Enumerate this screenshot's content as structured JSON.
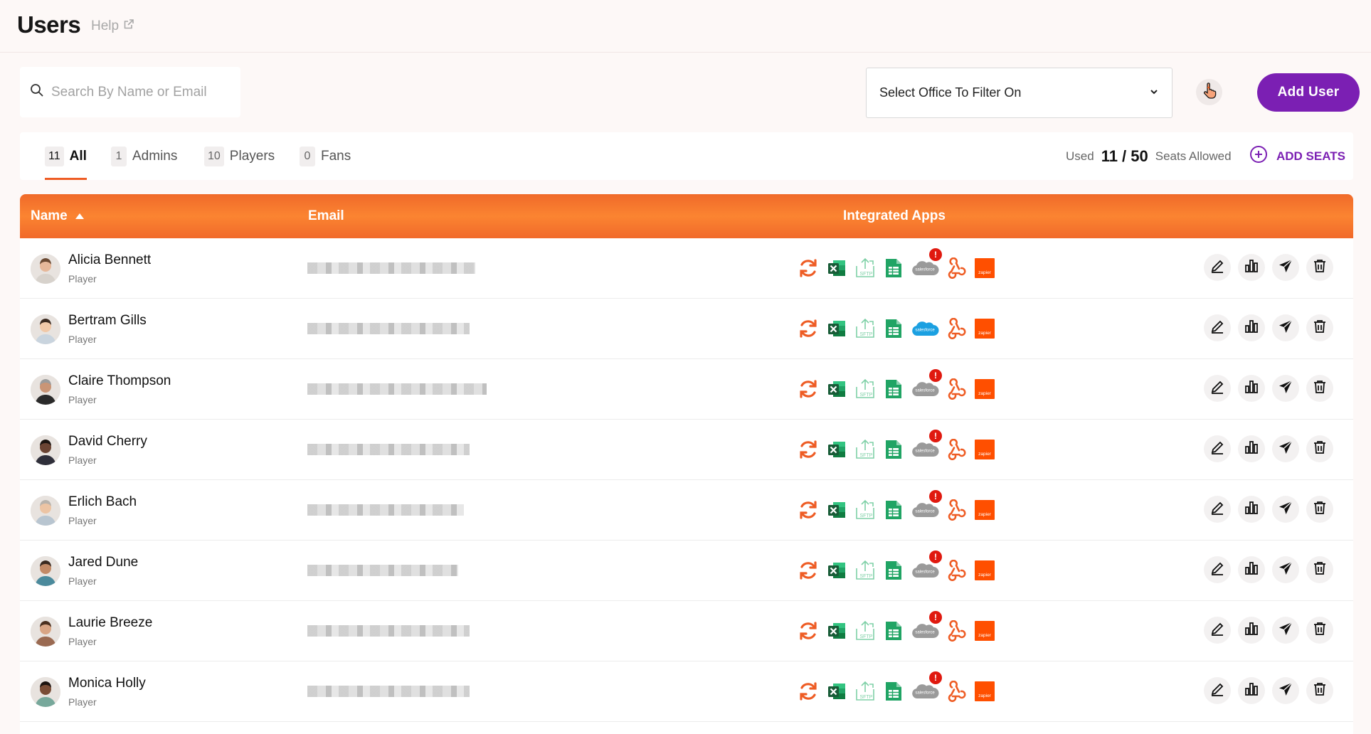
{
  "header": {
    "title": "Users",
    "help_label": "Help"
  },
  "search": {
    "placeholder": "Search By Name or Email",
    "value": ""
  },
  "office_filter": {
    "selected": "Select Office To Filter On"
  },
  "add_user_label": "Add User",
  "tabs": [
    {
      "count": "11",
      "label": "All",
      "active": true
    },
    {
      "count": "1",
      "label": "Admins",
      "active": false
    },
    {
      "count": "10",
      "label": "Players",
      "active": false
    },
    {
      "count": "0",
      "label": "Fans",
      "active": false
    }
  ],
  "seats": {
    "used_label": "Used",
    "value": "11 / 50",
    "allowed_label": "Seats Allowed",
    "add_label": "ADD SEATS"
  },
  "table": {
    "columns": {
      "name": "Name",
      "email": "Email",
      "apps": "Integrated Apps"
    },
    "sort": "name-ascending",
    "app_icons": [
      "sync-icon",
      "excel-icon",
      "sftp-icon",
      "google-sheets-icon",
      "salesforce-icon",
      "webhook-icon",
      "zapier-icon"
    ],
    "rows": [
      {
        "name": "Alicia Bennett",
        "role": "Player",
        "salesforce_connected": false,
        "salesforce_alert": "!"
      },
      {
        "name": "Bertram Gills",
        "role": "Player",
        "salesforce_connected": true,
        "salesforce_alert": ""
      },
      {
        "name": "Claire Thompson",
        "role": "Player",
        "salesforce_connected": false,
        "salesforce_alert": "!"
      },
      {
        "name": "David Cherry",
        "role": "Player",
        "salesforce_connected": false,
        "salesforce_alert": "!"
      },
      {
        "name": "Erlich Bach",
        "role": "Player",
        "salesforce_connected": false,
        "salesforce_alert": "!"
      },
      {
        "name": "Jared Dune",
        "role": "Player",
        "salesforce_connected": false,
        "salesforce_alert": "!"
      },
      {
        "name": "Laurie Breeze",
        "role": "Player",
        "salesforce_connected": false,
        "salesforce_alert": "!"
      },
      {
        "name": "Monica Holly",
        "role": "Player",
        "salesforce_connected": false,
        "salesforce_alert": "!"
      }
    ],
    "app_text": {
      "sftp": "SFTP",
      "salesforce": "salesforce",
      "zapier": "zapier"
    }
  },
  "colors": {
    "accent": "#ee5c24",
    "brand_purple": "#7b1fb3",
    "header_orange": "#f47a2e",
    "alert_red": "#e0190f",
    "salesforce_blue": "#1ba0e1",
    "salesforce_gray": "#9a9a9a",
    "excel_green": "#1d7044",
    "sheets_green": "#20a464"
  }
}
